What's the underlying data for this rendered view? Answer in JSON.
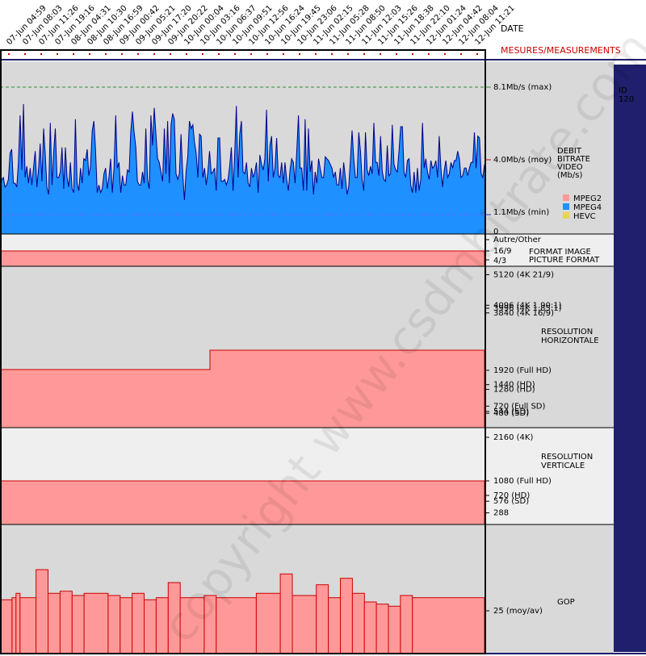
{
  "header": {
    "date_label": "DATE",
    "measures_label": "MESURES/MEASUREMENTS",
    "side_id_label": "ID",
    "side_id_value": "120",
    "watermark": "copyright www.csdmbitrate.com"
  },
  "colors": {
    "panel_bg": "#d9d9d9",
    "panel_bg_light": "#efefef",
    "mpeg2": "#ff9999",
    "mpeg4": "#1e90ff",
    "hevc": "#e8d44d",
    "outline": "#cc0000",
    "sidebar": "#1f1f6e",
    "max_line": "#2e8b2e",
    "avg_text": "#cc0000",
    "min_line": "#3333cc"
  },
  "chart_data": [
    {
      "type": "area",
      "name": "bitrate",
      "label_lines": [
        "DEBIT",
        "BITRATE",
        "VIDEO",
        "(Mb/s)"
      ],
      "max_label": "8.1Mb/s (max)",
      "avg_label": "4.0Mb/s (moy)",
      "min_label": "1.1Mb/s (min)",
      "zero_label": "0",
      "ylim": [
        0,
        9
      ],
      "x_dates": [
        "07-Jun 04:59",
        "07-Jun 08:03",
        "07-Jun 11:26",
        "07-Jun 19:16",
        "08-Jun 04:31",
        "08-Jun 10:30",
        "08-Jun 16:59",
        "09-Jun 00:42",
        "09-Jun 05:21",
        "09-Jun 17:20",
        "09-Jun 20:22",
        "10-Jun 00:04",
        "10-Jun 03:16",
        "10-Jun 06:37",
        "10-Jun 09:51",
        "10-Jun 12:56",
        "10-Jun 16:24",
        "10-Jun 19:45",
        "10-Jun 23:06",
        "11-Jun 02:15",
        "11-Jun 05:28",
        "11-Jun 08:50",
        "11-Jun 12:03",
        "11-Jun 15:26",
        "11-Jun 18:38",
        "11-Jun 22:10",
        "12-Jun 01:24",
        "12-Jun 04:42",
        "12-Jun 08:04",
        "12-Jun 11:21"
      ],
      "values": [
        2.3,
        2.9,
        3.0,
        2.5,
        2.6,
        2.9,
        4.3,
        4.5,
        2.7,
        2.7,
        2.5,
        3.8,
        6.3,
        3.4,
        6.9,
        3.0,
        3.6,
        2.7,
        3.5,
        2.6,
        3.5,
        4.4,
        2.5,
        3.5,
        4.8,
        2.8,
        5.6,
        4.2,
        2.5,
        2.1,
        5.9,
        2.6,
        4.3,
        5.6,
        3.0,
        3.0,
        3.3,
        4.6,
        2.4,
        4.6,
        3.0,
        2.5,
        3.8,
        2.4,
        2.2,
        6.1,
        2.7,
        2.3,
        3.5,
        2.7,
        4.0,
        3.9,
        4.5,
        3.1,
        3.6,
        5.5,
        6.0,
        4.5,
        2.2,
        2.6,
        2.2,
        2.4,
        3.2,
        3.5,
        2.4,
        3.0,
        4.0,
        2.2,
        3.5,
        6.3,
        3.5,
        3.8,
        2.2,
        3.1,
        2.6,
        2.6,
        3.4,
        3.3,
        5.4,
        6.5,
        5.4,
        4.6,
        2.8,
        2.6,
        2.6,
        3.3,
        2.7,
        5.6,
        2.9,
        2.4,
        6.3,
        4.7,
        6.7,
        5.3,
        4.0,
        3.8,
        3.3,
        2.8,
        5.6,
        3.2,
        6.0,
        2.7,
        5.8,
        6.4,
        6.1,
        3.2,
        2.9,
        3.2,
        5.3,
        3.2,
        1.8,
        3.3,
        4.1,
        6.0,
        5.6,
        5.8,
        4.9,
        4.3,
        3.0,
        5.3,
        5.2,
        3.0,
        3.5,
        2.6,
        3.3,
        4.4,
        3.2,
        3.3,
        3.5,
        2.3,
        5.1,
        5.1,
        2.8,
        2.8,
        2.9,
        2.6,
        2.9,
        3.6,
        4.6,
        2.3,
        4.3,
        6.8,
        3.0,
        5.3,
        6.0,
        3.3,
        3.2,
        3.8,
        2.7,
        2.5,
        3.5,
        3.0,
        3.3,
        3.8,
        2.2,
        4.2,
        3.7,
        3.4,
        4.0,
        6.6,
        2.8,
        4.7,
        5.2,
        3.0,
        3.5,
        5.1,
        3.1,
        3.0,
        3.8,
        2.7,
        3.8,
        2.9,
        2.3,
        3.4,
        4.0,
        3.8,
        2.7,
        4.4,
        6.3,
        3.5,
        3.5,
        2.3,
        6.1,
        2.3,
        5.6,
        3.3,
        3.9,
        2.1,
        3.3,
        2.7,
        4.0,
        3.5,
        3.0,
        3.0,
        4.1,
        4.0,
        3.9,
        3.7,
        3.5,
        3.0,
        3.3,
        2.6,
        2.6,
        3.5,
        2.4,
        3.8,
        3.0,
        2.1,
        2.5,
        3.9,
        5.5,
        4.0,
        3.0,
        3.0,
        5.4,
        4.4,
        2.9,
        2.3,
        5.4,
        3.4,
        3.1,
        3.6,
        3.2,
        5.9,
        3.8,
        3.8,
        3.1,
        5.2,
        3.3,
        2.9,
        2.8,
        4.7,
        3.1,
        3.2,
        5.8,
        3.7,
        3.4,
        3.3,
        4.4,
        5.7,
        5.7,
        3.3,
        3.0,
        3.9,
        4.0,
        2.6,
        2.2,
        3.3,
        2.2,
        3.5,
        2.3,
        2.9,
        5.9,
        3.5,
        4.0,
        3.3,
        2.9,
        3.9,
        3.5,
        3.6,
        3.9,
        3.0,
        5.2,
        3.5,
        2.5,
        3.4,
        3.9,
        3.0,
        3.2,
        3.8,
        3.5,
        3.9,
        3.9,
        4.4,
        4.0,
        3.0,
        3.1,
        3.5,
        3.5,
        3.1,
        3.5,
        3.8,
        3.8,
        5.4,
        3.5,
        5.2,
        5.1,
        3.2,
        3.0,
        3.7
      ],
      "series": [
        {
          "name": "MPEG2",
          "color": "#ff9999"
        },
        {
          "name": "MPEG4",
          "color": "#1e90ff"
        },
        {
          "name": "HEVC",
          "color": "#e8d44d"
        }
      ]
    },
    {
      "type": "area",
      "name": "picture-format",
      "label_lines": [
        "FORMAT IMAGE",
        "PICTURE FORMAT"
      ],
      "levels": [
        "Autre/Other",
        "16/9",
        "4/3"
      ],
      "value": "16/9"
    },
    {
      "type": "line",
      "name": "horizontal-resolution",
      "label_lines": [
        "RESOLUTION",
        "HORIZONTALE"
      ],
      "ylim": [
        0,
        5400
      ],
      "ticks": [
        {
          "value": 5120,
          "label": "5120 (4K 21/9)"
        },
        {
          "value": 4096,
          "label": "4096 (4K 1.90:1)"
        },
        {
          "value": 3996,
          "label": "3996 (4K 1.85:1)"
        },
        {
          "value": 3840,
          "label": "3840 (4K 16/9)"
        },
        {
          "value": 1920,
          "label": "1920 (Full HD)"
        },
        {
          "value": 1440,
          "label": "1440 (HD)"
        },
        {
          "value": 1280,
          "label": "1280 (HD)"
        },
        {
          "value": 720,
          "label": "720 (Full SD)"
        },
        {
          "value": 544,
          "label": "544 (SD)"
        },
        {
          "value": 480,
          "label": "480 (SD)"
        }
      ],
      "steps": [
        {
          "from_date": "07-Jun 04:59",
          "value": 1440
        },
        {
          "from_date": "10-Jun 03:16",
          "value": 1920
        }
      ]
    },
    {
      "type": "line",
      "name": "vertical-resolution",
      "label_lines": [
        "RESOLUTION",
        "VERTICALE"
      ],
      "ylim": [
        0,
        2400
      ],
      "ticks": [
        {
          "value": 2160,
          "label": "2160 (4K)"
        },
        {
          "value": 1080,
          "label": "1080 (Full HD)"
        },
        {
          "value": 720,
          "label": "720 (HD)"
        },
        {
          "value": 576,
          "label": "576 (SD)"
        },
        {
          "value": 288,
          "label": "288"
        }
      ],
      "value": 1080
    },
    {
      "type": "bar",
      "name": "gop",
      "label": "GOP",
      "avg_label": "25 (moy/av)",
      "avg": 25,
      "ylim": [
        0,
        60
      ],
      "values": [
        25,
        25,
        25,
        26,
        28,
        26,
        26,
        26,
        26,
        39,
        39,
        39,
        28,
        28,
        28,
        29,
        29,
        29,
        27,
        27,
        27,
        28,
        28,
        28,
        28,
        28,
        28,
        27,
        27,
        27,
        26,
        26,
        26,
        28,
        28,
        28,
        25,
        25,
        25,
        26,
        26,
        26,
        33,
        33,
        33,
        26,
        26,
        26,
        26,
        26,
        26,
        27,
        27,
        27,
        26,
        26,
        26,
        26,
        26,
        26,
        26,
        26,
        26,
        26,
        28,
        28,
        28,
        28,
        28,
        28,
        37,
        37,
        37,
        27,
        27,
        27,
        27,
        27,
        27,
        32,
        32,
        32,
        26,
        26,
        26,
        35,
        35,
        35,
        28,
        28,
        28,
        24,
        24,
        24,
        23,
        23,
        23,
        22,
        22,
        22,
        27,
        27,
        27,
        26,
        26,
        26,
        26,
        26,
        26,
        26,
        26,
        26,
        26,
        26,
        26,
        26,
        26,
        26,
        26,
        26,
        26
      ]
    }
  ]
}
